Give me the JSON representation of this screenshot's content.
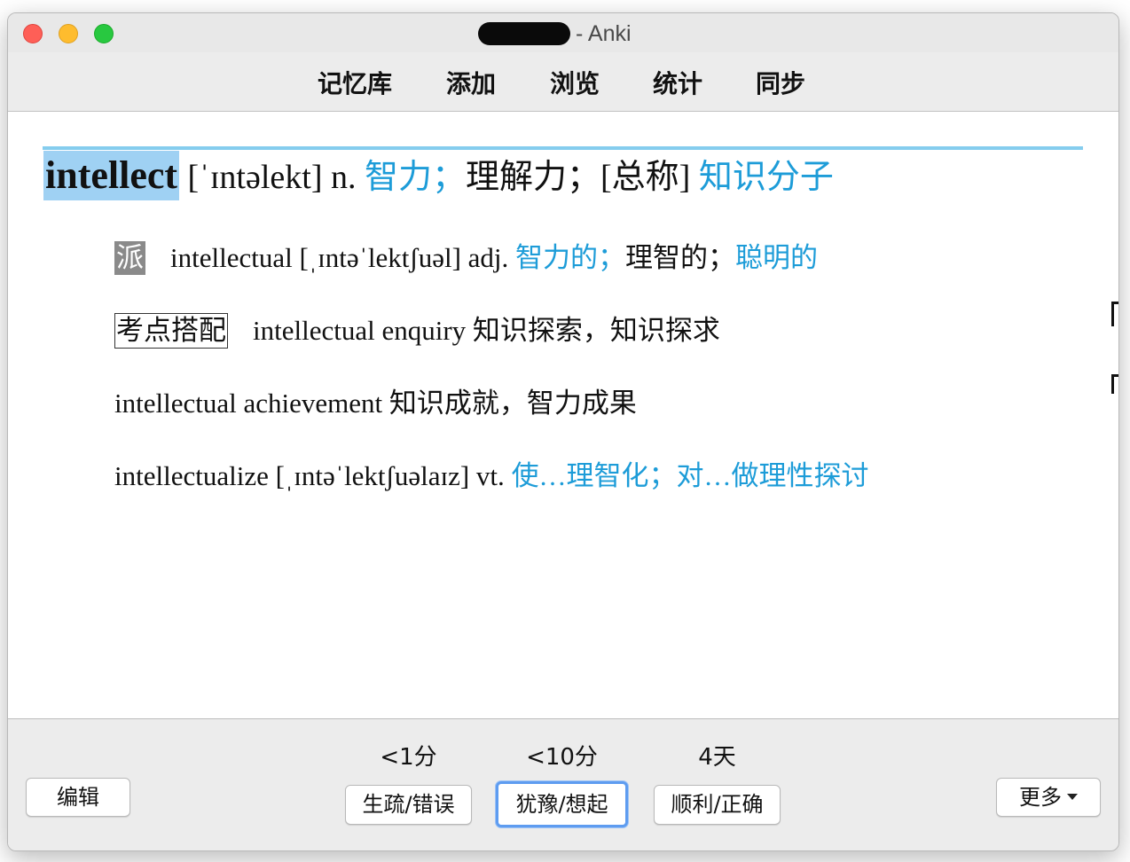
{
  "window": {
    "title": "- Anki"
  },
  "toolbar": {
    "decks": "记忆库",
    "add": "添加",
    "browse": "浏览",
    "stats": "统计",
    "sync": "同步"
  },
  "card": {
    "headword": "intellect",
    "phonetic": "[ˈɪntəlekt] n.",
    "meaning1": "智力；",
    "meaning2": "理解力；",
    "meaning3": "[总称]",
    "meaning4": "知识分子",
    "derived": {
      "tag": "派",
      "word": "intellectual [ˌɪntəˈlektʃuəl] adj.",
      "meaning1": "智力的；",
      "meaning2": "理智的；",
      "meaning3": "聪明的"
    },
    "collocations": {
      "tag": "考点搭配",
      "item1": "intellectual enquiry 知识探索，知识探求",
      "item2": "intellectual achievement 知识成就，智力成果"
    },
    "derived2": {
      "word": "intellectualize [ˌɪntəˈlektʃuəlaɪz] vt.",
      "meaning": "使…理智化；对…做理性探讨"
    }
  },
  "bottom": {
    "edit": "编辑",
    "more": "更多",
    "again": {
      "interval": "<1分",
      "label": "生疏/错误"
    },
    "hard": {
      "interval": "<10分",
      "label": "犹豫/想起"
    },
    "good": {
      "interval": "4天",
      "label": "顺利/正确"
    }
  },
  "colors": {
    "accent_blue": "#1d9cd8",
    "highlight": "#9fd1f3",
    "rule": "#85cdee",
    "focus_ring": "#5e9cf0"
  }
}
